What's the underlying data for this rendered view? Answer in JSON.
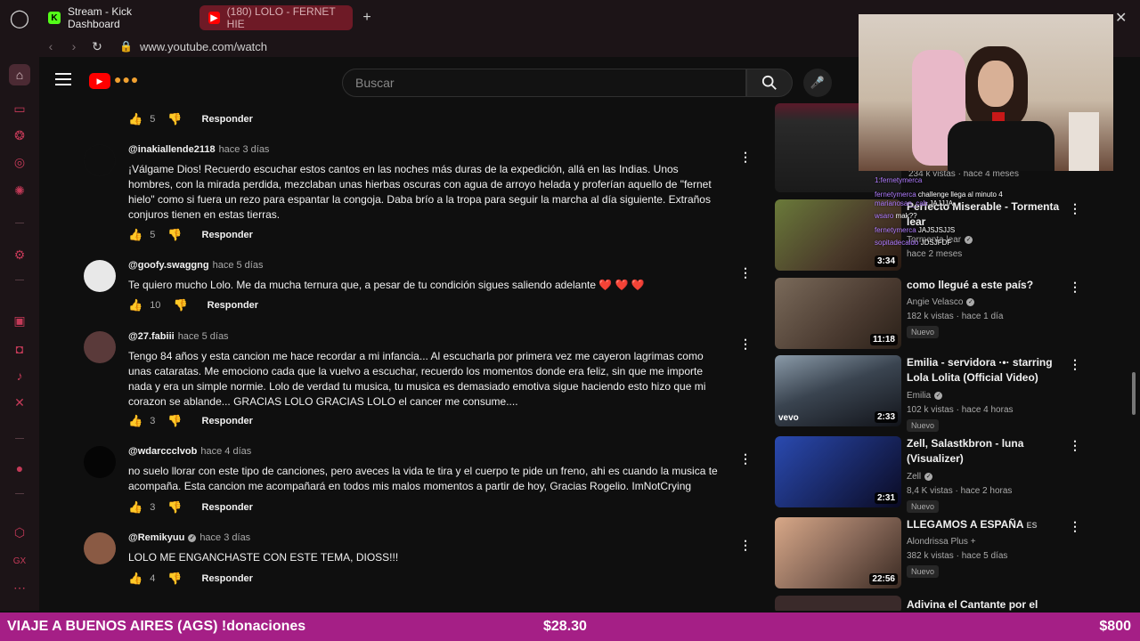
{
  "browser": {
    "tabs": [
      {
        "label": "Stream - Kick Dashboard",
        "icon": "kick-icon",
        "color": "#53fc18"
      },
      {
        "label": "(180) LOLO - FERNET HIE",
        "icon": "youtube-icon",
        "color": "#ff0000"
      }
    ],
    "new_tab": "+",
    "url": "www.youtube.com/watch"
  },
  "youtube": {
    "search_placeholder": "Buscar"
  },
  "comments": [
    {
      "actions": {
        "likes": "5",
        "reply": "Responder"
      }
    },
    {
      "handle": "@inakiallende2118",
      "time": "hace 3 días",
      "text": "¡Válgame Dios! Recuerdo escuchar estos cantos en las noches más duras de la expedición, allá en las Indias. Unos hombres, con la mirada perdida, mezclaban unas hierbas oscuras con agua de arroyo helada y proferían aquello de \"fernet hielo\" como si fuera un rezo para espantar la congoja. Daba brío a la tropa para seguir la marcha al día siguiente. Extraños conjuros tienen en estas tierras.",
      "likes": "5",
      "reply": "Responder",
      "avatar_color": "#0f0f0f"
    },
    {
      "handle": "@goofy.swaggng",
      "time": "hace 5 días",
      "text": "Te quiero mucho Lolo. Me da mucha ternura que, a pesar de tu condición sigues saliendo adelante",
      "hearts": "❤️ ❤️ ❤️",
      "likes": "10",
      "reply": "Responder",
      "avatar_color": "#e8e8e8"
    },
    {
      "handle": "@27.fabiii",
      "time": "hace 5 días",
      "text": "Tengo 84 años y esta cancion me hace recordar a mi infancia... Al escucharla por primera vez me cayeron lagrimas como unas cataratas. Me emociono cada que la vuelvo a escuchar, recuerdo los momentos donde era feliz, sin que me importe nada y era un simple normie. Lolo de verdad tu musica, tu musica es demasiado emotiva sigue haciendo esto hizo que mi corazon se ablande... GRACIAS LOLO GRACIAS LOLO el cancer me consume....",
      "likes": "3",
      "reply": "Responder",
      "avatar_color": "#5a3a3a"
    },
    {
      "handle": "@wdarccclvob",
      "time": "hace 4 días",
      "text": "no suelo llorar con este tipo de canciones, pero aveces la vida te tira y el cuerpo te pide un freno, ahi es cuando la musica te acompaña.  Esta cancion me acompañará en todos mis malos momentos a partir de hoy, Gracias Rogelio. ImNotCrying",
      "likes": "3",
      "reply": "Responder",
      "avatar_color": "#050505"
    },
    {
      "handle": "@Remikyuu",
      "time": "hace 3 días",
      "text": "LOLO ME ENGANCHASTE CON ESTE TEMA, DIOSS!!!",
      "likes": "4",
      "reply": "Responder",
      "avatar_color": "#8a5a44"
    }
  ],
  "videos": [
    {
      "title": "",
      "meta": "234 k vistas · hace 4 meses",
      "colors": [
        "#3a3a3a",
        "#1a1a1a"
      ]
    },
    {
      "title": "Perfecto Miserable - Tormenta lear",
      "channel": "Tormenta lear",
      "meta": "hace 2 meses",
      "duration": "3:34",
      "colors": [
        "#6a7a3a",
        "#3a2a1a"
      ]
    },
    {
      "title": "como llegué a este país?",
      "channel": "Angie Velasco",
      "meta": "182 k vistas · hace 1 día",
      "badge": "Nuevo",
      "duration": "11:18",
      "colors": [
        "#6a5a4a",
        "#3a2a22"
      ]
    },
    {
      "title": "Emilia - servidora ·•· starring Lola Lolita (Official Video)",
      "channel": "Emilia",
      "meta": "102 k vistas · hace 4 horas",
      "badge": "Nuevo",
      "duration": "2:33",
      "vevo": "vevo",
      "colors": [
        "#7a8a9a",
        "#1a1a22"
      ]
    },
    {
      "title": "Zell, Salastkbron - luna (Visualizer)",
      "channel": "Zell",
      "meta": "8,4 K vistas · hace 2 horas",
      "badge": "Nuevo",
      "duration": "2:31",
      "colors": [
        "#1a3a8a",
        "#0a0a2a"
      ]
    },
    {
      "title": "LLEGAMOS A ESPAÑA",
      "title_suffix": "ES",
      "channel": "Alondrissa Plus",
      "meta": "382 k vistas · hace 5 días",
      "badge": "Nuevo",
      "duration": "22:56",
      "colors": [
        "#c89a7a",
        "#5a3a2a"
      ]
    },
    {
      "title": "Adivina el Cantante por el"
    }
  ],
  "stream_chat": [
    {
      "user": "1:fernetymerca",
      "msg": ""
    },
    {
      "user": "fernetymerca",
      "msg": "challenge llega al minuto 4"
    },
    {
      "user": "marianosan_cab",
      "msg": "JAJJJA"
    },
    {
      "user": "wsaro",
      "msg": "mak??"
    },
    {
      "user": "fernetymerca",
      "msg": "JAJSJSJJS"
    },
    {
      "user": "sopitadecaldo",
      "msg": "JDSJFDF"
    }
  ],
  "bottom_bar": {
    "title": "VIAJE A BUENOS AIRES (AGS) !donaciones",
    "amount_current": "$28.30",
    "amount_goal": "$800"
  }
}
